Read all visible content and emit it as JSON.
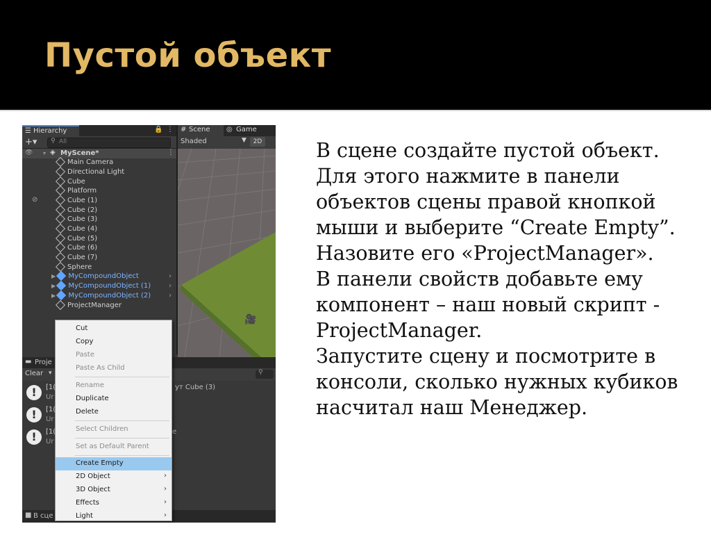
{
  "slide": {
    "title": "Пустой объект",
    "title_color": "#e2b864",
    "paragraph1": "В сцене создайте пустой объект. Для этого нажмите в панели объектов сцены правой кнопкой мыши и выберите “Create Empty”. Назовите его «ProjectManager».",
    "paragraph2": "В панели свойств добавьте ему компонент – наш новый скрипт - ProjectManager.",
    "paragraph3": "Запустите сцену и посмотрите в консоли, сколько нужных кубиков насчитал наш Менеджер."
  },
  "unity": {
    "hierarchy": {
      "tab_label": "Hierarchy",
      "search_placeholder": "All",
      "scene_name": "MyScene*",
      "items": [
        {
          "label": "Main Camera"
        },
        {
          "label": "Directional Light"
        },
        {
          "label": "Cube"
        },
        {
          "label": "Platform"
        },
        {
          "label": "Cube (1)"
        },
        {
          "label": "Cube (2)"
        },
        {
          "label": "Cube (3)"
        },
        {
          "label": "Cube (4)"
        },
        {
          "label": "Cube (5)"
        },
        {
          "label": "Cube (6)"
        },
        {
          "label": "Cube (7)"
        },
        {
          "label": "Sphere"
        },
        {
          "label": "MyCompoundObject"
        },
        {
          "label": "MyCompoundObject (1)"
        },
        {
          "label": "MyCompoundObject (2)"
        },
        {
          "label": "ProjectManager"
        }
      ]
    },
    "scene_view": {
      "scene_tab": "Scene",
      "game_tab": "Game",
      "shading_mode": "Shaded",
      "mode_2d": "2D",
      "ground_color": "#6f8c34"
    },
    "bottom_panel": {
      "tab_label": "Proje",
      "clear_label": "Clear",
      "log_prefix": "[1(",
      "log_sub": "Ur",
      "log1_suffix": "ут Cube (3)",
      "log3_suffix": "е",
      "status_text": "В сце"
    },
    "context_menu": {
      "cut": "Cut",
      "copy": "Copy",
      "paste": "Paste",
      "paste_as_child": "Paste As Child",
      "rename": "Rename",
      "duplicate": "Duplicate",
      "delete": "Delete",
      "select_children": "Select Children",
      "set_default_parent": "Set as Default Parent",
      "create_empty": "Create Empty",
      "object_2d": "2D Object",
      "object_3d": "3D Object",
      "effects": "Effects",
      "light": "Light"
    }
  }
}
